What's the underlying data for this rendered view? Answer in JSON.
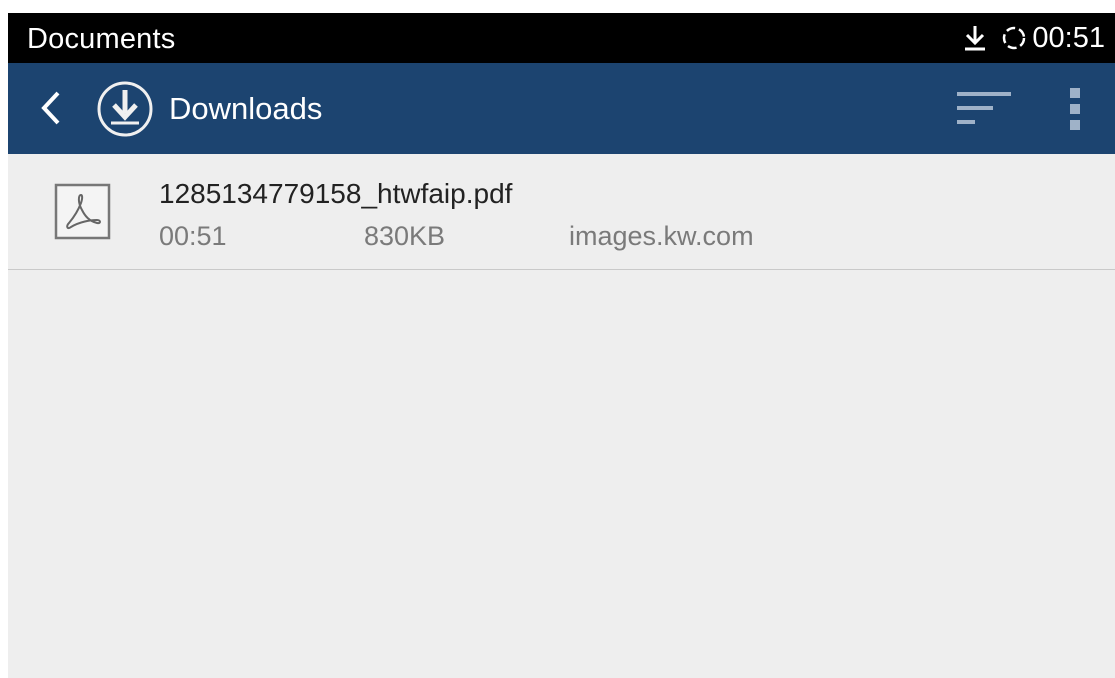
{
  "status_bar": {
    "title": "Documents",
    "time": "00:51",
    "icons": [
      "download-icon",
      "sync-icon"
    ]
  },
  "app_bar": {
    "title": "Downloads",
    "background": "#1c4470",
    "icons": [
      "back-icon",
      "downloads-icon",
      "sort-icon",
      "more-vert-icon"
    ]
  },
  "files": [
    {
      "name": "1285134779158_htwfaip.pdf",
      "time": "00:51",
      "size": "830KB",
      "source": "images.kw.com",
      "icon": "pdf-icon"
    }
  ]
}
